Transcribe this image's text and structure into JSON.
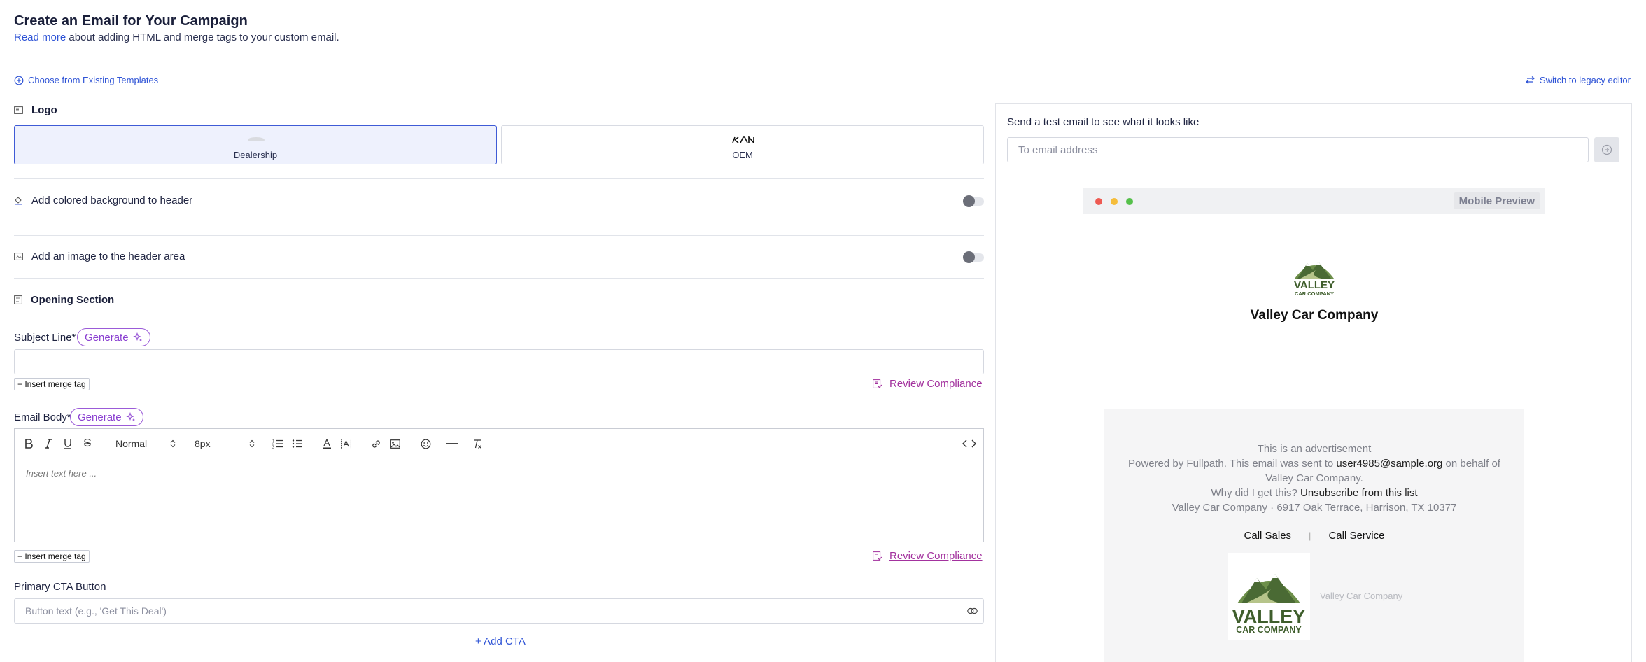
{
  "header": {
    "title": "Create an Email for Your Campaign",
    "read_more_link": "Read more",
    "subtitle_rest": " about adding HTML and merge tags to your custom email."
  },
  "links": {
    "choose_templates": "Choose from Existing Templates",
    "switch_legacy": "Switch to legacy editor"
  },
  "logo_section": {
    "title": "Logo",
    "options": [
      {
        "label": "Dealership",
        "selected": true
      },
      {
        "label": "OEM",
        "selected": false
      }
    ]
  },
  "header_options": {
    "colored_bg_label": "Add colored background to header",
    "colored_bg_on": false,
    "header_image_label": "Add an image to the header area",
    "header_image_on": false
  },
  "opening_section": {
    "title": "Opening Section",
    "subject_label": "Subject Line*",
    "generate_label": "Generate",
    "subject_value": "",
    "merge_tag_label": "+ Insert merge tag",
    "review_label": "Review Compliance",
    "body_label": "Email Body*",
    "body_placeholder": "Insert text here ...",
    "toolbar": {
      "style_select": "Normal",
      "size_select": "8px"
    },
    "cta_label": "Primary CTA Button",
    "cta_placeholder": "Button text (e.g., 'Get This Deal')",
    "add_cta": "+ Add CTA"
  },
  "preview": {
    "test_label": "Send a test email to see what it looks like",
    "test_placeholder": "To email address",
    "mobile_preview": "Mobile Preview",
    "logo_word": "VALLEY",
    "logo_sub": "CAR COMPANY",
    "company_name": "Valley Car Company",
    "footer": {
      "ad_line": "This is an advertisement",
      "powered_prefix": "Powered by Fullpath. This email was sent to ",
      "email": "user4985@sample.org",
      "powered_suffix": " on behalf of Valley Car Company.",
      "why": "Why did I get this? ",
      "unsubscribe": "Unsubscribe from this list",
      "address": "Valley Car Company · 6917 Oak Terrace, Harrison, TX 10377",
      "call_sales": "Call Sales",
      "separator": "|",
      "call_service": "Call Service",
      "logo_name": "Valley Car Company"
    }
  },
  "colors": {
    "accent_blue": "#2f54d6",
    "purple": "#8a3fd1",
    "magenta": "#a3329e",
    "mac_red": "#ee5a52",
    "mac_yellow": "#f5bd3b",
    "mac_green": "#55c04a",
    "logo_green": "#3f5e2c"
  }
}
